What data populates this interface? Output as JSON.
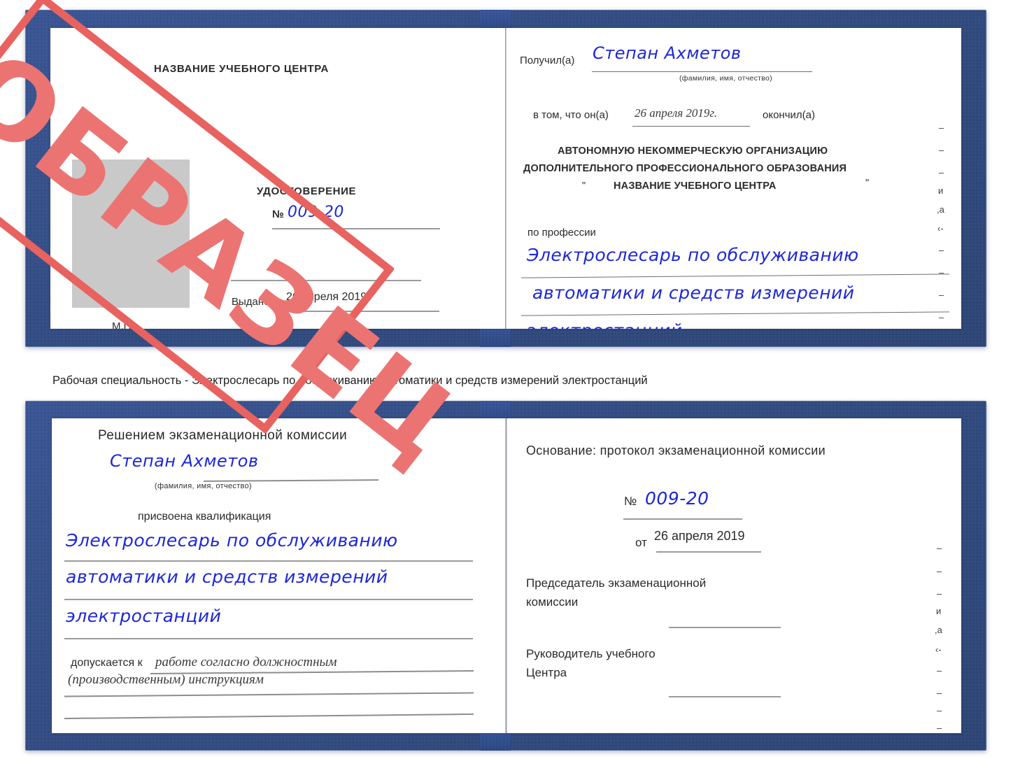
{
  "document": {
    "kind": "Russian training-centre certificate (udostoverenie) scan, two spreads",
    "watermark": "ОБРАЗЕЦ",
    "watermark_color": "#e8625f",
    "handwriting_color": "#1c27d8",
    "cover_color": "#22407f"
  },
  "caption": {
    "text": "Рабочая специальность - Электрослесарь по обслуживанию автоматики и средств измерений электростанций"
  },
  "cert_top": {
    "left_page": {
      "header": "НАЗВАНИЕ УЧЕБНОГО ЦЕНТРА",
      "doc_type": "УДОСТОВЕРЕНИЕ",
      "number_prefix": "№",
      "number_value": "009-20",
      "issued_label": "Выдано",
      "issued_value": "26 апреля 2019",
      "seal_label": "М.П."
    },
    "right_page": {
      "received_label": "Получил(а)",
      "received_value": "Степан Ахметов",
      "fio_hint": "(фамилия, имя, отчество)",
      "that_he_label": "в том, что он(а)",
      "that_he_value": "26 апреля 2019г.",
      "finished_label": "окончил(а)",
      "org_line1": "АВТОНОМНУЮ НЕКОММЕРЧЕСКУЮ ОРГАНИЗАЦИЮ",
      "org_line2": "ДОПОЛНИТЕЛЬНОГО ПРОФЕССИОНАЛЬНОГО ОБРАЗОВАНИЯ",
      "org_quote_open": "\"",
      "org_line3": "НАЗВАНИЕ УЧЕБНОГО ЦЕНТРА",
      "org_quote_close": "\"",
      "profession_label": "по профессии",
      "profession_line1": "Электрослесарь по обслуживанию",
      "profession_line2": "автоматики и средств измерений",
      "profession_line3": "электростанций",
      "edge_chars": [
        "–",
        "–",
        "–",
        "и",
        ",а",
        "‹-",
        "–",
        "–",
        "–",
        "–"
      ]
    }
  },
  "cert_bottom": {
    "left_page": {
      "header": "Решением экзаменационной комиссии",
      "name_value": "Степан Ахметов",
      "fio_hint": "(фамилия, имя, отчество)",
      "qualification_label": "присвоена квалификация",
      "qualification_line1": "Электрослесарь по обслуживанию",
      "qualification_line2": "автоматики и средств измерений",
      "qualification_line3": "электростанций",
      "admitted_label": "допускается к",
      "admitted_line1": "работе согласно должностным",
      "admitted_line2": "(производственным) инструкциям"
    },
    "right_page": {
      "basis_label": "Основание: протокол экзаменационной комиссии",
      "number_prefix": "№",
      "number_value": "009-20",
      "date_prefix": "от",
      "date_value": "26 апреля 2019",
      "chairman_line1": "Председатель экзаменационной",
      "chairman_line2": "комиссии",
      "head_line1": "Руководитель учебного",
      "head_line2": "Центра",
      "edge_chars": [
        "–",
        "–",
        "–",
        "и",
        ",а",
        "‹-",
        "–",
        "–",
        "–",
        "–"
      ]
    }
  }
}
